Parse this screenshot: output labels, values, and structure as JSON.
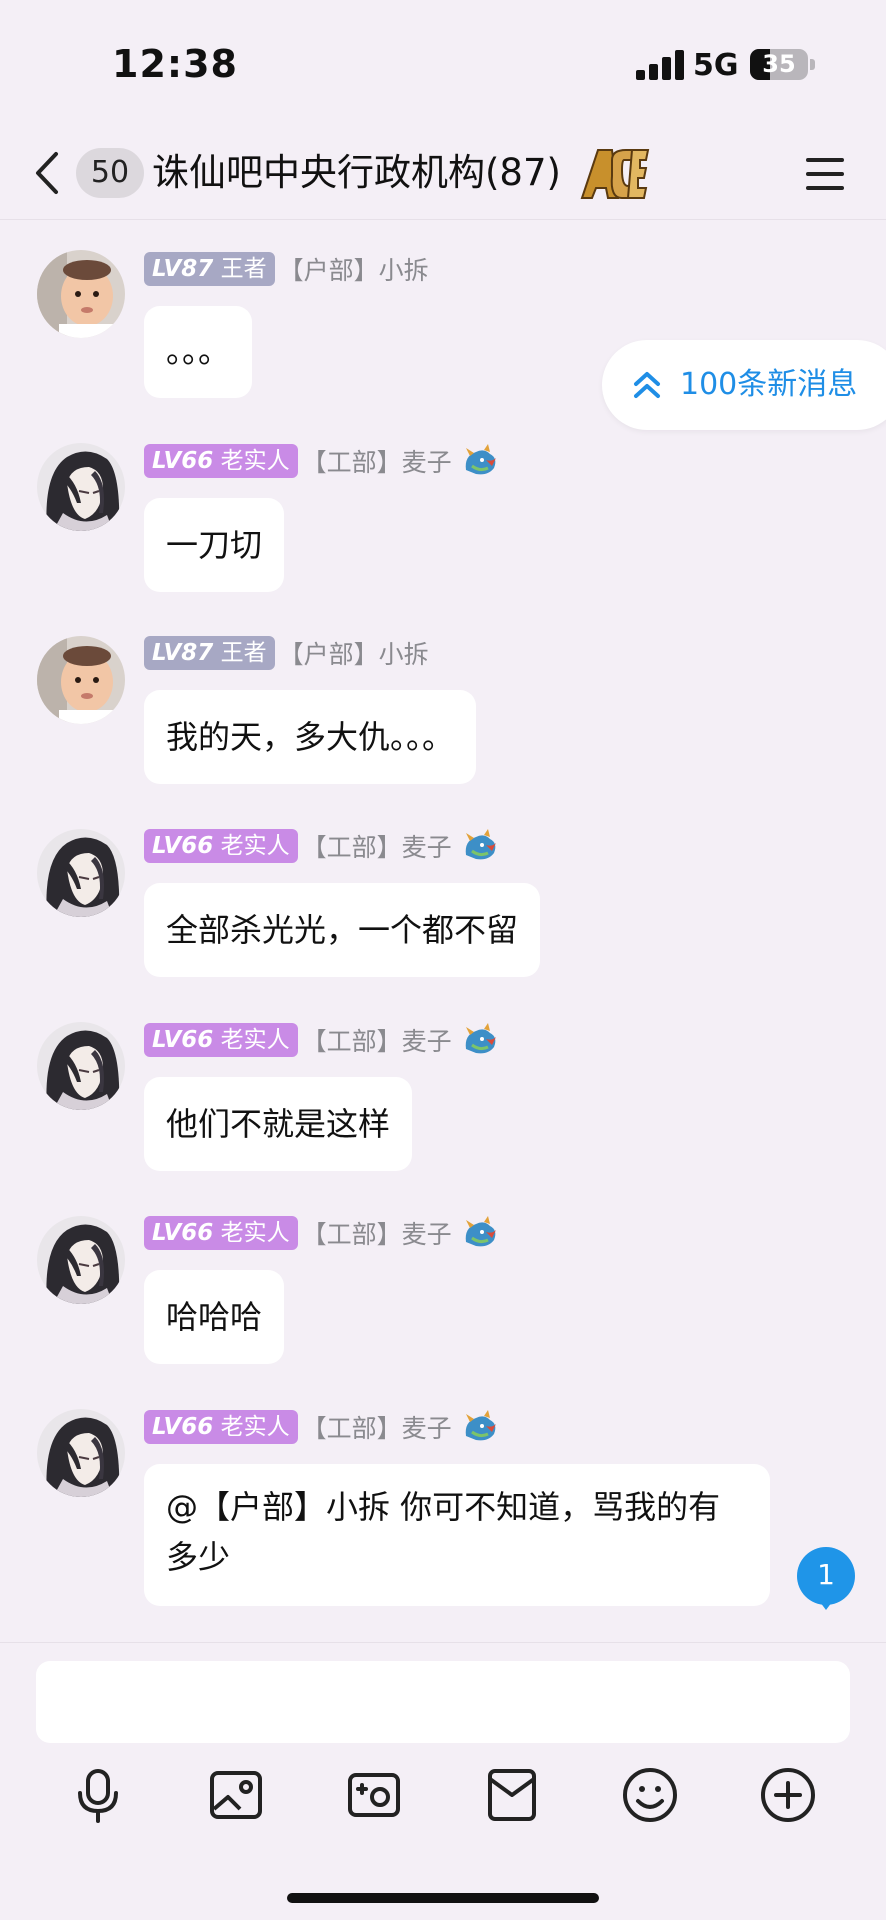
{
  "status": {
    "time": "12:38",
    "network": "5G",
    "battery": "35",
    "battery_level": 0.35
  },
  "header": {
    "unread_count": "50",
    "title": "诛仙吧中央行政机构(87)",
    "icons": [
      "back-icon",
      "ace-badge-icon",
      "menu-icon"
    ]
  },
  "new_messages": {
    "label": "100条新消息",
    "icon": "double-chevron-up-icon"
  },
  "messages": [
    {
      "level": "LV87",
      "title": "王者",
      "sender": "【户部】小拆",
      "text": "。。。",
      "avatar": "baby-avatar",
      "badge_color": "#a7a8c4"
    },
    {
      "level": "LV66",
      "title": "老实人",
      "sender": "【工部】麦子",
      "text": "一刀切",
      "avatar": "anime-avatar",
      "badge_color": "#c98be6"
    },
    {
      "level": "LV87",
      "title": "王者",
      "sender": "【户部】小拆",
      "text": "我的天，多大仇。。。",
      "avatar": "baby-avatar",
      "badge_color": "#a7a8c4"
    },
    {
      "level": "LV66",
      "title": "老实人",
      "sender": "【工部】麦子",
      "text": "全部杀光光，一个都不留",
      "avatar": "anime-avatar",
      "badge_color": "#c98be6"
    },
    {
      "level": "LV66",
      "title": "老实人",
      "sender": "【工部】麦子",
      "text": "他们不就是这样",
      "avatar": "anime-avatar",
      "badge_color": "#c98be6"
    },
    {
      "level": "LV66",
      "title": "老实人",
      "sender": "【工部】麦子",
      "text": "哈哈哈",
      "avatar": "anime-avatar",
      "badge_color": "#c98be6"
    },
    {
      "level": "LV66",
      "title": "老实人",
      "sender": "【工部】麦子",
      "text": "@【户部】小拆 你可不知道，骂我的有多少",
      "avatar": "anime-avatar",
      "badge_color": "#c98be6"
    }
  ],
  "mention_badge": "1",
  "toolbar": [
    "microphone-icon",
    "image-icon",
    "camera-icon",
    "file-icon",
    "emoji-icon",
    "plus-icon"
  ]
}
